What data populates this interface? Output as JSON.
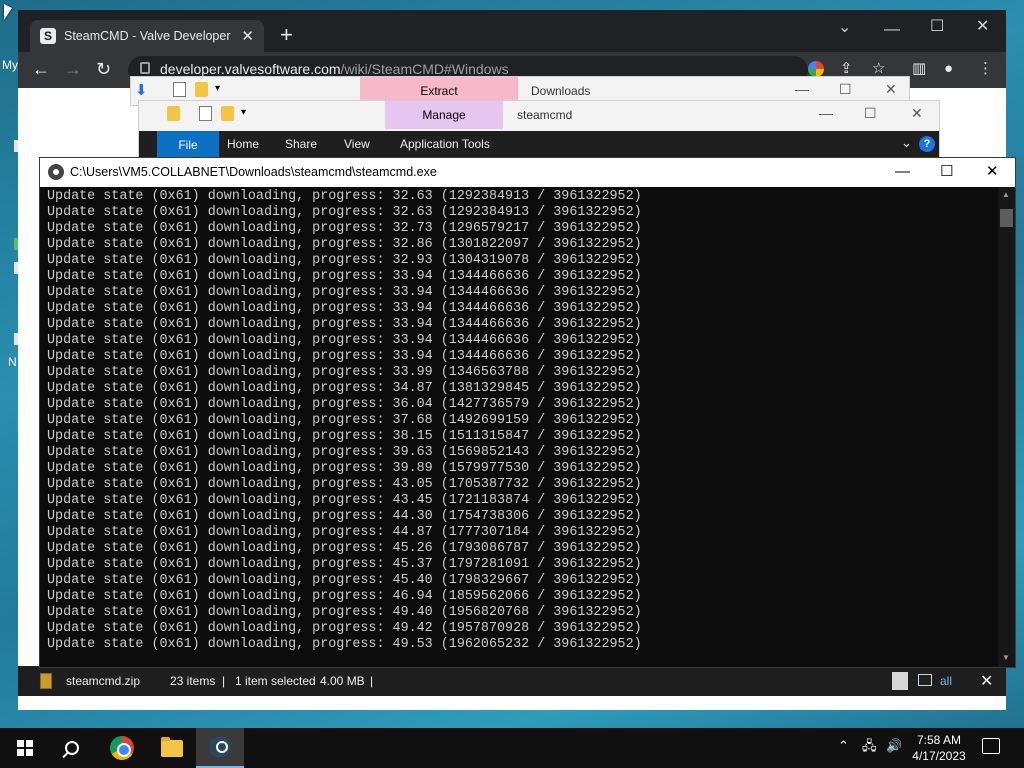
{
  "desktop": {
    "label_top": "My",
    "label_bottom": "N"
  },
  "chrome": {
    "tab_title": "SteamCMD - Valve Developer Co",
    "favicon_letter": "S",
    "url_domain": "developer.valvesoftware.com",
    "url_path": "/wiki/SteamCMD#Windows",
    "icons": [
      "back-arrow-icon",
      "forward-arrow-icon",
      "reload-icon",
      "google-icon",
      "share-icon",
      "star-icon",
      "sidebar-icon",
      "profile-icon",
      "menu-icon"
    ]
  },
  "explorer_back": {
    "context_tab": "Extract",
    "title": "Downloads",
    "context_color": "#f7b8cc"
  },
  "explorer_front": {
    "context_tab": "Manage",
    "title": "steamcmd",
    "context_color": "#e6c6f0",
    "tabs": [
      "File",
      "Home",
      "Share",
      "View",
      "Application Tools"
    ]
  },
  "explorer_status": {
    "selected_file": "steamcmd.zip",
    "item_count": "23 items",
    "selection": "1 item selected",
    "size": "4.00 MB",
    "sep": "|",
    "partial_text": "all"
  },
  "console": {
    "title": "C:\\Users\\VM5.COLLABNET\\Downloads\\steamcmd\\steamcmd.exe",
    "log_prefix": "Update state (0x61) downloading, progress: ",
    "total_bytes": "3961322952",
    "lines": [
      [
        "32.63",
        "1292384913"
      ],
      [
        "32.63",
        "1292384913"
      ],
      [
        "32.73",
        "1296579217"
      ],
      [
        "32.86",
        "1301822097"
      ],
      [
        "32.93",
        "1304319078"
      ],
      [
        "33.94",
        "1344466636"
      ],
      [
        "33.94",
        "1344466636"
      ],
      [
        "33.94",
        "1344466636"
      ],
      [
        "33.94",
        "1344466636"
      ],
      [
        "33.94",
        "1344466636"
      ],
      [
        "33.94",
        "1344466636"
      ],
      [
        "33.99",
        "1346563788"
      ],
      [
        "34.87",
        "1381329845"
      ],
      [
        "36.04",
        "1427736579"
      ],
      [
        "37.68",
        "1492699159"
      ],
      [
        "38.15",
        "1511315847"
      ],
      [
        "39.63",
        "1569852143"
      ],
      [
        "39.89",
        "1579977530"
      ],
      [
        "43.05",
        "1705387732"
      ],
      [
        "43.45",
        "1721183874"
      ],
      [
        "44.30",
        "1754738306"
      ],
      [
        "44.87",
        "1777307184"
      ],
      [
        "45.26",
        "1793086787"
      ],
      [
        "45.37",
        "1797281091"
      ],
      [
        "45.40",
        "1798329667"
      ],
      [
        "46.94",
        "1859562066"
      ],
      [
        "49.40",
        "1956820768"
      ],
      [
        "49.42",
        "1957870928"
      ],
      [
        "49.53",
        "1962065232"
      ]
    ]
  },
  "taskbar": {
    "time": "7:58 AM",
    "date": "4/17/2023",
    "apps": [
      "start-button",
      "search-button",
      "chrome-app",
      "file-explorer-app",
      "steam-app"
    ]
  }
}
